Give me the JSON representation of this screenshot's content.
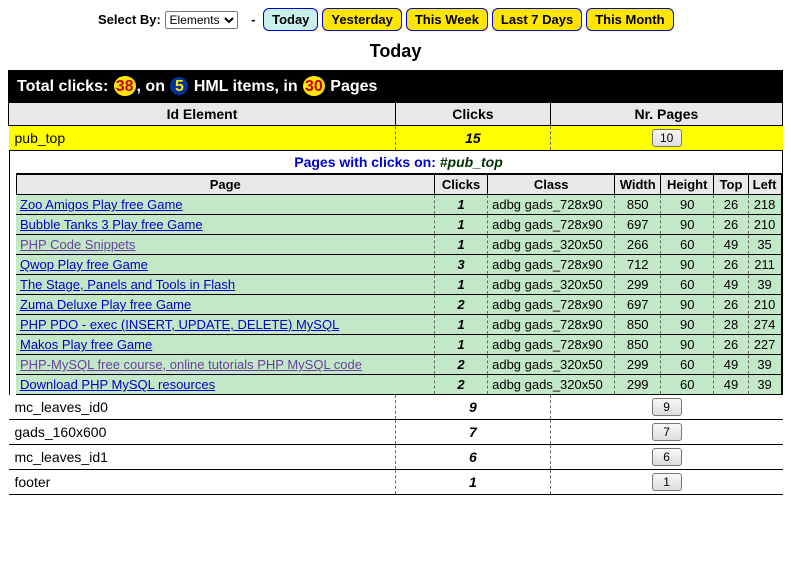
{
  "controls": {
    "select_by_label": "Select By:",
    "select_value": "Elements",
    "filters": [
      "Today",
      "Yesterday",
      "This Week",
      "Last 7 Days",
      "This Month"
    ],
    "active_filter": "Today"
  },
  "page_title": "Today",
  "total": {
    "prefix": "Total clicks: ",
    "clicks": "38",
    "mid1": ", on ",
    "items": "5",
    "mid2": " HML items, in ",
    "pages": "30",
    "suffix": " Pages"
  },
  "outer_headers": {
    "id": "Id Element",
    "clicks": "Clicks",
    "pages": "Nr. Pages"
  },
  "highlight_row": {
    "id": "pub_top",
    "clicks": "15",
    "pages_btn": "10"
  },
  "sub_title_prefix": "Pages with clicks on: ",
  "sub_title_id": "#pub_top",
  "inner_headers": {
    "page": "Page",
    "clicks": "Clicks",
    "class": "Class",
    "width": "Width",
    "height": "Height",
    "top": "Top",
    "left": "Left"
  },
  "inner_rows": [
    {
      "page": "Zoo Amigos Play free Game",
      "visited": false,
      "clicks": "1",
      "class": "adbg gads_728x90",
      "w": "850",
      "h": "90",
      "t": "26",
      "l": "218"
    },
    {
      "page": "Bubble Tanks 3 Play free Game",
      "visited": false,
      "clicks": "1",
      "class": "adbg gads_728x90",
      "w": "697",
      "h": "90",
      "t": "26",
      "l": "210"
    },
    {
      "page": "PHP Code Snippets",
      "visited": true,
      "clicks": "1",
      "class": "adbg gads_320x50",
      "w": "266",
      "h": "60",
      "t": "49",
      "l": "35"
    },
    {
      "page": "Qwop Play free Game",
      "visited": false,
      "clicks": "3",
      "class": "adbg gads_728x90",
      "w": "712",
      "h": "90",
      "t": "26",
      "l": "211"
    },
    {
      "page": "The Stage, Panels and Tools in Flash",
      "visited": false,
      "clicks": "1",
      "class": "adbg gads_320x50",
      "w": "299",
      "h": "60",
      "t": "49",
      "l": "39"
    },
    {
      "page": "Zuma Deluxe Play free Game",
      "visited": false,
      "clicks": "2",
      "class": "adbg gads_728x90",
      "w": "697",
      "h": "90",
      "t": "26",
      "l": "210"
    },
    {
      "page": "PHP PDO - exec (INSERT, UPDATE, DELETE) MySQL",
      "visited": false,
      "clicks": "1",
      "class": "adbg gads_728x90",
      "w": "850",
      "h": "90",
      "t": "28",
      "l": "274"
    },
    {
      "page": "Makos Play free Game",
      "visited": false,
      "clicks": "1",
      "class": "adbg gads_728x90",
      "w": "850",
      "h": "90",
      "t": "26",
      "l": "227"
    },
    {
      "page": "PHP-MySQL free course, online tutorials PHP MySQL code",
      "visited": true,
      "clicks": "2",
      "class": "adbg gads_320x50",
      "w": "299",
      "h": "60",
      "t": "49",
      "l": "39"
    },
    {
      "page": "Download PHP MySQL resources",
      "visited": false,
      "clicks": "2",
      "class": "adbg gads_320x50",
      "w": "299",
      "h": "60",
      "t": "49",
      "l": "39"
    }
  ],
  "footer_rows": [
    {
      "id": "mc_leaves_id0",
      "clicks": "9",
      "pages_btn": "9"
    },
    {
      "id": "gads_160x600",
      "clicks": "7",
      "pages_btn": "7"
    },
    {
      "id": "mc_leaves_id1",
      "clicks": "6",
      "pages_btn": "6"
    },
    {
      "id": "footer",
      "clicks": "1",
      "pages_btn": "1"
    }
  ]
}
